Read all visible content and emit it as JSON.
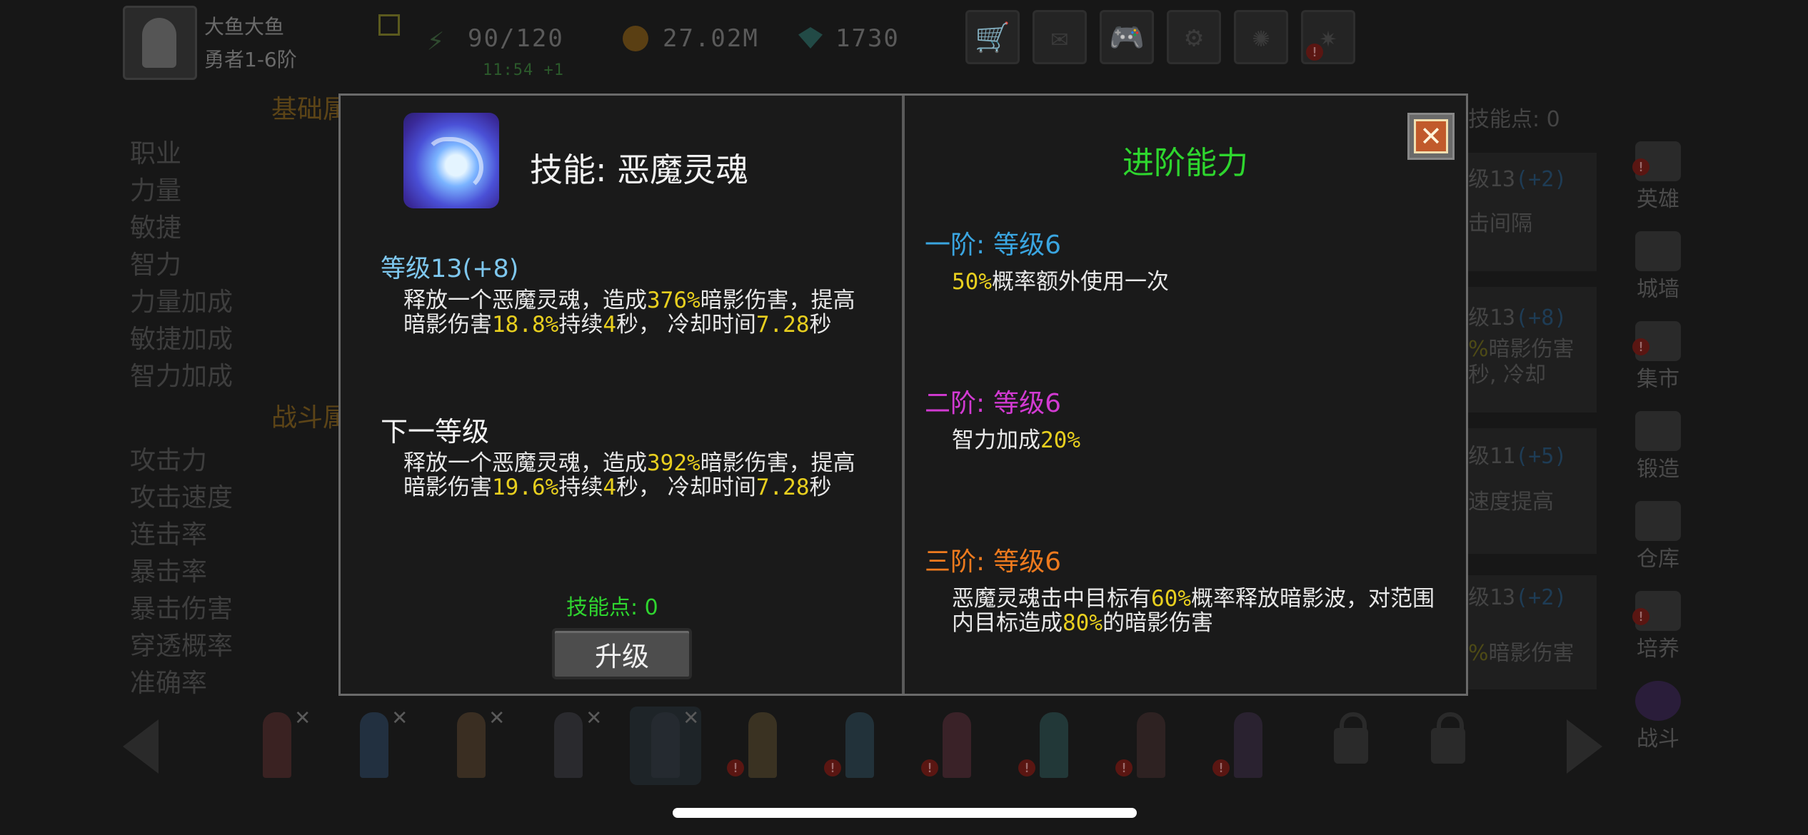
{
  "player": {
    "name": "大鱼大鱼",
    "rank": "勇者1-6阶"
  },
  "resources": {
    "energy": "90/120",
    "energy_timer": "11:54 +1",
    "gold": "27.02M",
    "gems": "1730"
  },
  "top_buttons": [
    "cart-icon",
    "mail-icon",
    "gamepad-icon",
    "gear-icon",
    "pinwheel-icon",
    "fireworks-icon"
  ],
  "left_panel": {
    "section_basic": "基础属",
    "basic_stats": [
      "职业",
      "力量",
      "敏捷",
      "智力",
      "力量加成",
      "敏捷加成",
      "智力加成"
    ],
    "section_combat": "战斗属",
    "combat_stats": [
      "攻击力",
      "攻击速度",
      "连击率",
      "暴击率",
      "暴击伤害",
      "穿透概率",
      "准确率"
    ]
  },
  "bg_cards": {
    "skill_points": "技能点: 0",
    "card1": {
      "level": "级13",
      "bonus": "(+2)",
      "text": "击间隔"
    },
    "card2": {
      "level": "级13",
      "bonus": "(+8)",
      "text1_y": "%",
      "text1": "暗影伤害",
      "text2": "秒, 冷却"
    },
    "card3": {
      "level": "级11",
      "bonus": "(+5)",
      "text": "速度提高"
    },
    "card4": {
      "level": "级13",
      "bonus": "(+2)",
      "text_y": "%",
      "text": "暗影伤害"
    }
  },
  "sidebar": {
    "items": [
      {
        "label": "英雄",
        "icon": "hero-icon"
      },
      {
        "label": "城墙",
        "icon": "wall-icon"
      },
      {
        "label": "集市",
        "icon": "market-icon"
      },
      {
        "label": "锻造",
        "icon": "anvil-icon"
      },
      {
        "label": "仓库",
        "icon": "warehouse-icon"
      },
      {
        "label": "培养",
        "icon": "chalice-icon"
      },
      {
        "label": "战斗",
        "icon": "portal-icon"
      }
    ]
  },
  "modal": {
    "skill_title": "技能: 恶魔灵魂",
    "current_level": "等级13(+8)",
    "current_desc": {
      "p1": "释放一个恶魔灵魂，造成",
      "v1": "376%",
      "p2": "暗影伤害，提高暗影伤害",
      "v2": "18.8%",
      "p3": "持续",
      "v3": "4",
      "p4": "秒， 冷却时间",
      "v4": "7.28",
      "p5": "秒"
    },
    "next_label": "下一等级",
    "next_desc": {
      "p1": "释放一个恶魔灵魂，造成",
      "v1": "392%",
      "p2": "暗影伤害，提高暗影伤害",
      "v2": "19.6%",
      "p3": "持续",
      "v3": "4",
      "p4": "秒， 冷却时间",
      "v4": "7.28",
      "p5": "秒"
    },
    "skill_points": "技能点: 0",
    "upgrade_label": "升级",
    "advanced_title": "进阶能力",
    "tiers": [
      {
        "name": "一阶:",
        "level": "等级6",
        "color": "#3aa5e0",
        "desc_v1": "50%",
        "desc_p1": "概率额外使用一次"
      },
      {
        "name": "二阶:",
        "level": "等级6",
        "color": "#d23ad2",
        "desc_p0": "智力加成",
        "desc_v1": "20%"
      },
      {
        "name": "三阶:",
        "level": "等级6",
        "color": "#ee7a1e",
        "desc_p0": "恶魔灵魂击中目标有",
        "desc_v1": "60%",
        "desc_p1": "概率释放暗影波，对范围内目标造成",
        "desc_v2": "80%",
        "desc_p2": "的暗影伤害"
      }
    ]
  },
  "colors": {
    "highlight": "#e8cf1f",
    "level_blue": "#7ec7ee",
    "green": "#2ed62e"
  }
}
